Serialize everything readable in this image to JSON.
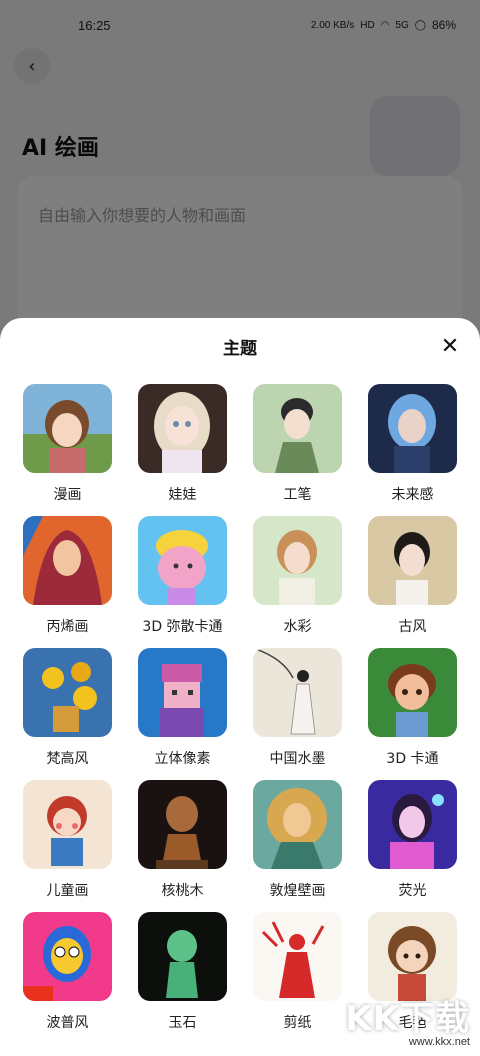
{
  "status_bar": {
    "time": "16:25",
    "network_speed": "2.00 KB/s",
    "network_type": "HD",
    "signal": "5G",
    "battery": "86%"
  },
  "page": {
    "title": "AI 绘画",
    "input_placeholder": "自由输入你想要的人物和画面"
  },
  "theme_sheet": {
    "title": "主题",
    "items": [
      {
        "label": "漫画",
        "icon": "anime-girl-thumb"
      },
      {
        "label": "娃娃",
        "icon": "doll-thumb"
      },
      {
        "label": "工笔",
        "icon": "gongbi-thumb"
      },
      {
        "label": "未来感",
        "icon": "futuristic-thumb"
      },
      {
        "label": "丙烯画",
        "icon": "acrylic-thumb"
      },
      {
        "label": "3D 弥散卡通",
        "icon": "3d-diffuse-cartoon-thumb"
      },
      {
        "label": "水彩",
        "icon": "watercolor-thumb"
      },
      {
        "label": "古风",
        "icon": "ancient-style-thumb"
      },
      {
        "label": "梵高风",
        "icon": "van-gogh-thumb"
      },
      {
        "label": "立体像素",
        "icon": "voxel-thumb"
      },
      {
        "label": "中国水墨",
        "icon": "ink-wash-thumb"
      },
      {
        "label": "3D 卡通",
        "icon": "3d-cartoon-thumb"
      },
      {
        "label": "儿童画",
        "icon": "child-drawing-thumb"
      },
      {
        "label": "核桃木",
        "icon": "walnut-wood-thumb"
      },
      {
        "label": "敦煌壁画",
        "icon": "dunhuang-thumb"
      },
      {
        "label": "荧光",
        "icon": "fluorescent-thumb"
      },
      {
        "label": "波普风",
        "icon": "pop-art-thumb"
      },
      {
        "label": "玉石",
        "icon": "jade-thumb"
      },
      {
        "label": "剪纸",
        "icon": "paper-cut-thumb"
      },
      {
        "label": "毛毡",
        "icon": "felt-thumb"
      }
    ]
  },
  "watermark": {
    "main": "KK下载",
    "sub": "www.kkx.net"
  },
  "colors": {
    "overlay": "#000000",
    "sheet_bg": "#ffffff",
    "accent_text": "#111111"
  }
}
